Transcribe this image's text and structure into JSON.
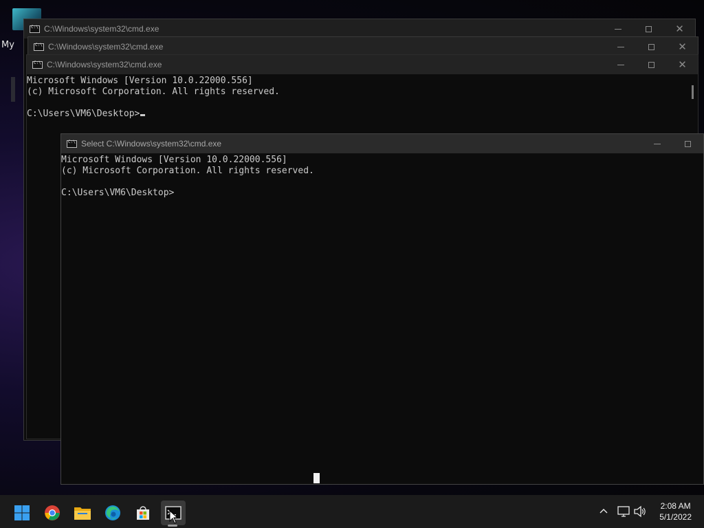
{
  "desktop": {
    "label": "My"
  },
  "windows": {
    "back": {
      "title": "C:\\Windows\\system32\\cmd.exe"
    },
    "middle": {
      "title": "C:\\Windows\\system32\\cmd.exe"
    },
    "front_bg": {
      "title": "C:\\Windows\\system32\\cmd.exe",
      "lines": [
        "Microsoft Windows [Version 10.0.22000.556]",
        "(c) Microsoft Corporation. All rights reserved.",
        "",
        "C:\\Users\\VM6\\Desktop>"
      ]
    },
    "select": {
      "title": "Select C:\\Windows\\system32\\cmd.exe",
      "lines": [
        "Microsoft Windows [Version 10.0.22000.556]",
        "(c) Microsoft Corporation. All rights reserved.",
        "",
        "C:\\Users\\VM6\\Desktop>"
      ]
    }
  },
  "taskbar": {
    "apps": [
      "start-icon",
      "chrome-icon",
      "file-explorer-icon",
      "edge-icon",
      "store-icon",
      "terminal-icon"
    ],
    "tray": {
      "time": "2:08 AM",
      "date": "5/1/2022"
    }
  }
}
